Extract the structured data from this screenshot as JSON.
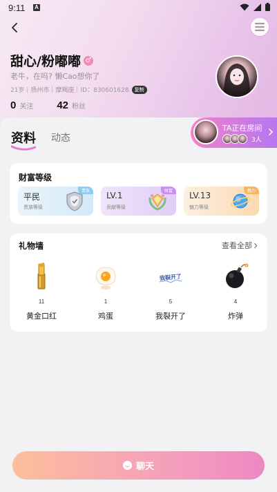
{
  "status_bar": {
    "time": "9:11",
    "notification_letter": "A"
  },
  "profile": {
    "name": "甜心/粉嘟嘟",
    "gender_symbol": "♂",
    "bio": "老牛，在吗? 懒Cao想你了",
    "age": "21岁",
    "city": "扬州市",
    "zodiac": "摩羯座",
    "id_text": "ID：830601628",
    "copy_label": "复制",
    "following_count": "0",
    "following_label": "关注",
    "followers_count": "42",
    "followers_label": "粉丝"
  },
  "tabs": {
    "active": "资料",
    "inactive": "动态"
  },
  "room": {
    "title": "TA正在房间",
    "count": "3人"
  },
  "wealth": {
    "title": "财富等级",
    "levels": [
      {
        "value": "平民",
        "sub": "贵族等级",
        "tag": "贵族",
        "tag_color": "#8ecbf0"
      },
      {
        "value": "LV.1",
        "sub": "贡献等级",
        "tag": "财富",
        "tag_color": "#c98ff0"
      },
      {
        "value": "LV.13",
        "sub": "魅力等级",
        "tag": "魅力",
        "tag_color": "#f5b566"
      }
    ]
  },
  "gift_wall": {
    "title": "礼物墙",
    "view_all": "查看全部",
    "gifts": [
      {
        "icon": "gold-lipstick-icon",
        "count": "11",
        "name": "黄金口红"
      },
      {
        "icon": "egg-icon",
        "count": "1",
        "name": "鸡蛋"
      },
      {
        "icon": "cracked-text-icon",
        "count": "5",
        "name": "我裂开了",
        "icon_text": "我裂开了"
      },
      {
        "icon": "bomb-icon",
        "count": "4",
        "name": "炸弹"
      }
    ]
  },
  "chat_button": {
    "label": "聊天"
  },
  "colors": {
    "accent_pink": "#f283c8",
    "accent_purple": "#b577f0",
    "chat_gradient_start": "#fdbe9c",
    "chat_gradient_end": "#ee88c3"
  }
}
